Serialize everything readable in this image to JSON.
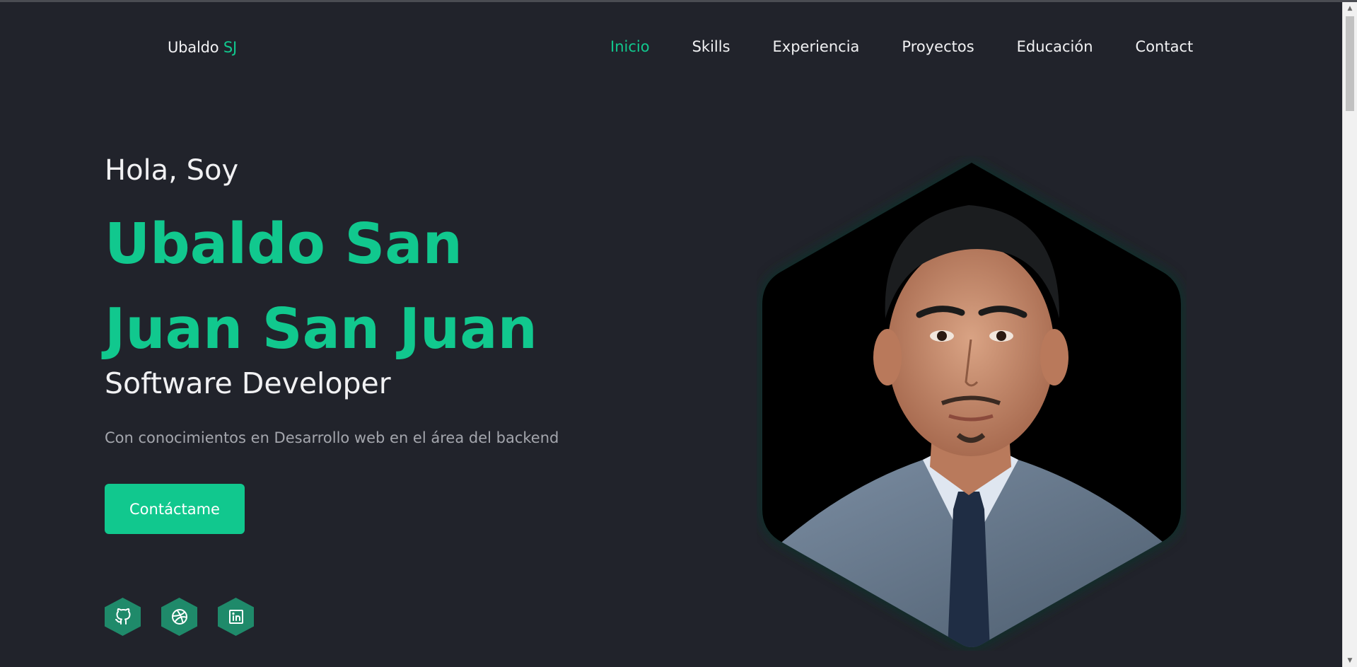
{
  "header": {
    "logo_name": "Ubaldo",
    "logo_accent": "SJ",
    "nav": [
      {
        "label": "Inicio",
        "active": true
      },
      {
        "label": "Skills",
        "active": false
      },
      {
        "label": "Experiencia",
        "active": false
      },
      {
        "label": "Proyectos",
        "active": false
      },
      {
        "label": "Educación",
        "active": false
      },
      {
        "label": "Contact",
        "active": false
      }
    ]
  },
  "hero": {
    "greeting": "Hola, Soy",
    "name": "Ubaldo San Juan San Juan",
    "role": "Software Developer",
    "description": "Con conocimientos en Desarrollo web en el área del backend",
    "cta_label": "Contáctame"
  },
  "socials": [
    {
      "icon": "github-icon"
    },
    {
      "icon": "dribbble-icon"
    },
    {
      "icon": "linkedin-icon"
    }
  ],
  "colors": {
    "background": "#21232b",
    "accent": "#11c88e",
    "social_bg": "#1f8a6a",
    "text": "#f1f1f3",
    "muted": "#a4a6ad"
  }
}
